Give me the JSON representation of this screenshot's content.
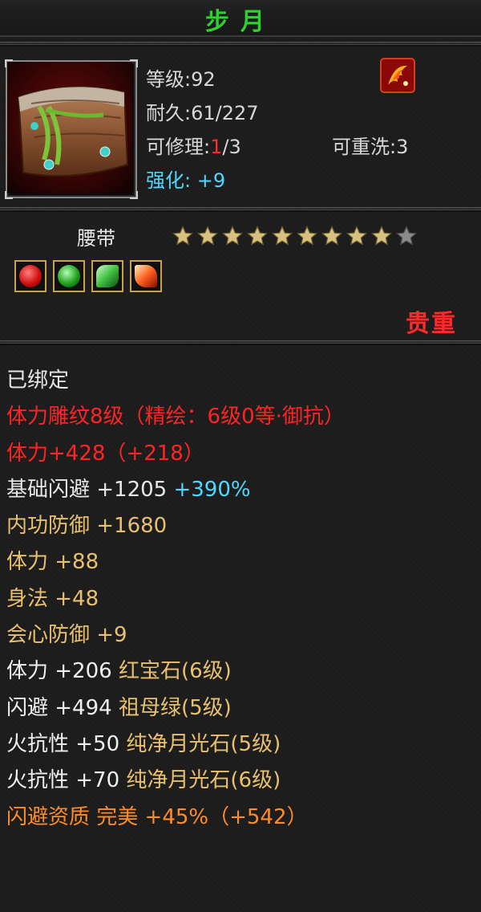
{
  "item": {
    "name": "步月",
    "level_text": "等级:92",
    "durability_text": "耐久:61/227",
    "repair_label": "可修理:",
    "repair_current": "1",
    "repair_total": "/3",
    "reroll_text": "可重洗:3",
    "enhance_label": "强化:",
    "enhance_value": "+9",
    "type": "腰带",
    "stars_filled": 9,
    "stars_total": 10,
    "quality": "贵重"
  },
  "attributes": [
    {
      "text": "已绑定",
      "color": "white"
    },
    {
      "text": "体力雕纹8级（精绘：6级0等·御抗）",
      "color": "red"
    },
    {
      "text": "体力+428（+218）",
      "color": "red"
    },
    {
      "text": "基础闪避 +1205 ",
      "extra": "+390%",
      "color": "white"
    },
    {
      "text": "内功防御 +1680",
      "color": "gold"
    },
    {
      "text": "体力 +88",
      "color": "gold"
    },
    {
      "text": "身法 +48",
      "color": "gold"
    },
    {
      "text": "会心防御 +9",
      "color": "gold"
    },
    {
      "text": "体力 +206 ",
      "extra": "红宝石(6级)",
      "color": "white"
    },
    {
      "text": "闪避 +494 ",
      "extra": "祖母绿(5级)",
      "color": "white"
    },
    {
      "text": "火抗性 +50 ",
      "extra": "纯净月光石(5级)",
      "color": "white"
    },
    {
      "text": "火抗性 +70 ",
      "extra": "纯净月光石(6级)",
      "color": "white"
    },
    {
      "text": "闪避资质  完美 +45%（+542）",
      "color": "orange"
    }
  ],
  "icons": {
    "badge": "fire-phoenix-icon",
    "gems": [
      "ruby-gem-icon",
      "emerald-gem-icon",
      "jade-gem-icon",
      "moonstone-gem-icon"
    ]
  },
  "colors": {
    "title": "#2fd12f",
    "red": "#ff2424",
    "gold": "#e8c070",
    "cyan": "#4fd8ff",
    "orange": "#ff8c2a"
  }
}
